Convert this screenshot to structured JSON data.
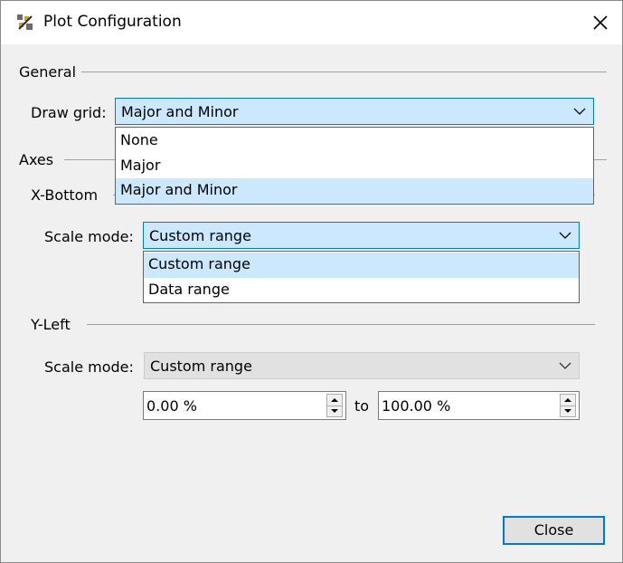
{
  "window": {
    "title": "Plot Configuration",
    "close_icon": "close-icon"
  },
  "general": {
    "title": "General",
    "draw_grid": {
      "label": "Draw grid:",
      "value": "Major and Minor",
      "options": [
        "None",
        "Major",
        "Major and Minor"
      ],
      "selected_index": 2
    }
  },
  "axes": {
    "title": "Axes",
    "x_bottom": {
      "title": "X-Bottom",
      "scale_mode": {
        "label": "Scale mode:",
        "value": "Custom range",
        "options": [
          "Custom range",
          "Data range"
        ],
        "selected_index": 0
      }
    },
    "y_left": {
      "title": "Y-Left",
      "scale_mode": {
        "label": "Scale mode:",
        "value": "Custom range",
        "enabled": false
      },
      "range_min": "0.00 %",
      "range_to": "to",
      "range_max": "100.00 %"
    }
  },
  "footer": {
    "close_label": "Close"
  },
  "colors": {
    "accent": "#0078d7",
    "selection": "#cce8ff",
    "background": "#f0f0f0"
  }
}
